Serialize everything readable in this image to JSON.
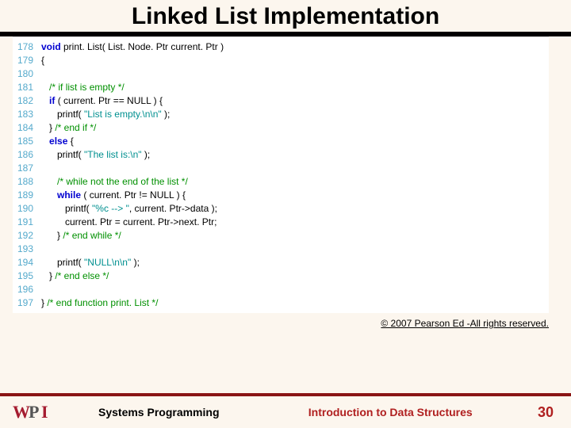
{
  "title": "Linked List Implementation",
  "code": {
    "lines": [
      {
        "n": "178",
        "pre": "",
        "kw": "void",
        "mid": " print. List( List. Node. Ptr current. Ptr )",
        "cm": "",
        "str": "",
        "post": ""
      },
      {
        "n": "179",
        "pre": "{",
        "kw": "",
        "mid": "",
        "cm": "",
        "str": "",
        "post": ""
      },
      {
        "n": "180",
        "pre": "",
        "kw": "",
        "mid": "",
        "cm": "",
        "str": "",
        "post": ""
      },
      {
        "n": "181",
        "pre": "   ",
        "kw": "",
        "mid": "",
        "cm": "/* if list is empty */",
        "str": "",
        "post": ""
      },
      {
        "n": "182",
        "pre": "   ",
        "kw": "if",
        "mid": " ( current. Ptr == NULL ) {",
        "cm": "",
        "str": "",
        "post": ""
      },
      {
        "n": "183",
        "pre": "      printf( ",
        "kw": "",
        "mid": "",
        "cm": "",
        "str": "\"List is empty.\\n\\n\"",
        "post": " );"
      },
      {
        "n": "184",
        "pre": "   } ",
        "kw": "",
        "mid": "",
        "cm": "/* end if */",
        "str": "",
        "post": ""
      },
      {
        "n": "185",
        "pre": "   ",
        "kw": "else",
        "mid": " {",
        "cm": "",
        "str": "",
        "post": ""
      },
      {
        "n": "186",
        "pre": "      printf( ",
        "kw": "",
        "mid": "",
        "cm": "",
        "str": "\"The list is:\\n\"",
        "post": " );"
      },
      {
        "n": "187",
        "pre": "",
        "kw": "",
        "mid": "",
        "cm": "",
        "str": "",
        "post": ""
      },
      {
        "n": "188",
        "pre": "      ",
        "kw": "",
        "mid": "",
        "cm": "/* while not the end of the list */",
        "str": "",
        "post": ""
      },
      {
        "n": "189",
        "pre": "      ",
        "kw": "while",
        "mid": " ( current. Ptr != NULL ) {",
        "cm": "",
        "str": "",
        "post": ""
      },
      {
        "n": "190",
        "pre": "         printf( ",
        "kw": "",
        "mid": "",
        "cm": "",
        "str": "\"%c --> \"",
        "post": ", current. Ptr->data );"
      },
      {
        "n": "191",
        "pre": "         current. Ptr = current. Ptr->next. Ptr;",
        "kw": "",
        "mid": "",
        "cm": "",
        "str": "",
        "post": ""
      },
      {
        "n": "192",
        "pre": "      } ",
        "kw": "",
        "mid": "",
        "cm": "/* end while */",
        "str": "",
        "post": ""
      },
      {
        "n": "193",
        "pre": "",
        "kw": "",
        "mid": "",
        "cm": "",
        "str": "",
        "post": ""
      },
      {
        "n": "194",
        "pre": "      printf( ",
        "kw": "",
        "mid": "",
        "cm": "",
        "str": "\"NULL\\n\\n\"",
        "post": " );"
      },
      {
        "n": "195",
        "pre": "   } ",
        "kw": "",
        "mid": "",
        "cm": "/* end else */",
        "str": "",
        "post": ""
      },
      {
        "n": "196",
        "pre": "",
        "kw": "",
        "mid": "",
        "cm": "",
        "str": "",
        "post": ""
      },
      {
        "n": "197",
        "pre": "} ",
        "kw": "",
        "mid": "",
        "cm": "/* end function print. List */",
        "str": "",
        "post": ""
      }
    ]
  },
  "copyright": "© 2007 Pearson Ed -All rights reserved.",
  "footer": {
    "left": "Systems Programming",
    "center": "Introduction to Data Structures",
    "page": "30"
  },
  "logo": {
    "text": "WPI"
  }
}
